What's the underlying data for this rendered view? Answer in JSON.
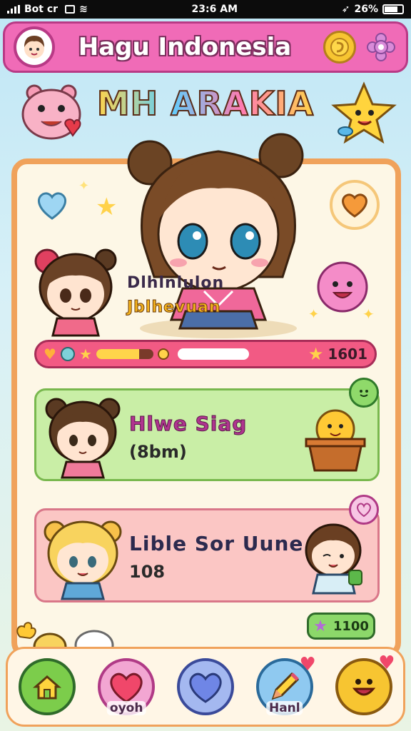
{
  "status_bar": {
    "carrier": "Bot cr",
    "time": "23:6 AM",
    "battery": "26%"
  },
  "header": {
    "title": "Hagu Indonesia"
  },
  "banner": {
    "title": "MH ARAKIA"
  },
  "hero": {
    "name": "Dlhlnlulon",
    "subtitle": "Jblhevuan"
  },
  "progress": {
    "score": "1601",
    "fill": 0.75
  },
  "cards": [
    {
      "title": "Hlwe Siag",
      "subtitle": "(8bm)",
      "title_color": "#b0348f"
    },
    {
      "title": "Lible Sor Uune",
      "subtitle": "108",
      "title_color": "#2c2a4e"
    }
  ],
  "reward": {
    "value": "1100"
  },
  "nav": [
    {
      "label": "",
      "icon": "house-icon",
      "color": "#7ccd4b"
    },
    {
      "label": "oyoh",
      "icon": "heart-icon",
      "color": "#f2a6d2"
    },
    {
      "label": "",
      "icon": "blue-heart-icon",
      "color": "#a4b8f0"
    },
    {
      "label": "Hanl",
      "icon": "pencil-icon",
      "color": "#8fc9f0"
    },
    {
      "label": "",
      "icon": "smile-face-icon",
      "color": "#f7c531"
    }
  ],
  "colors": {
    "header_bg": "#f06bb7",
    "panel_border": "#f0a25b",
    "progress_bg": "#f25a84",
    "card1_bg": "#c9eea6",
    "card2_bg": "#fbc6c4"
  }
}
